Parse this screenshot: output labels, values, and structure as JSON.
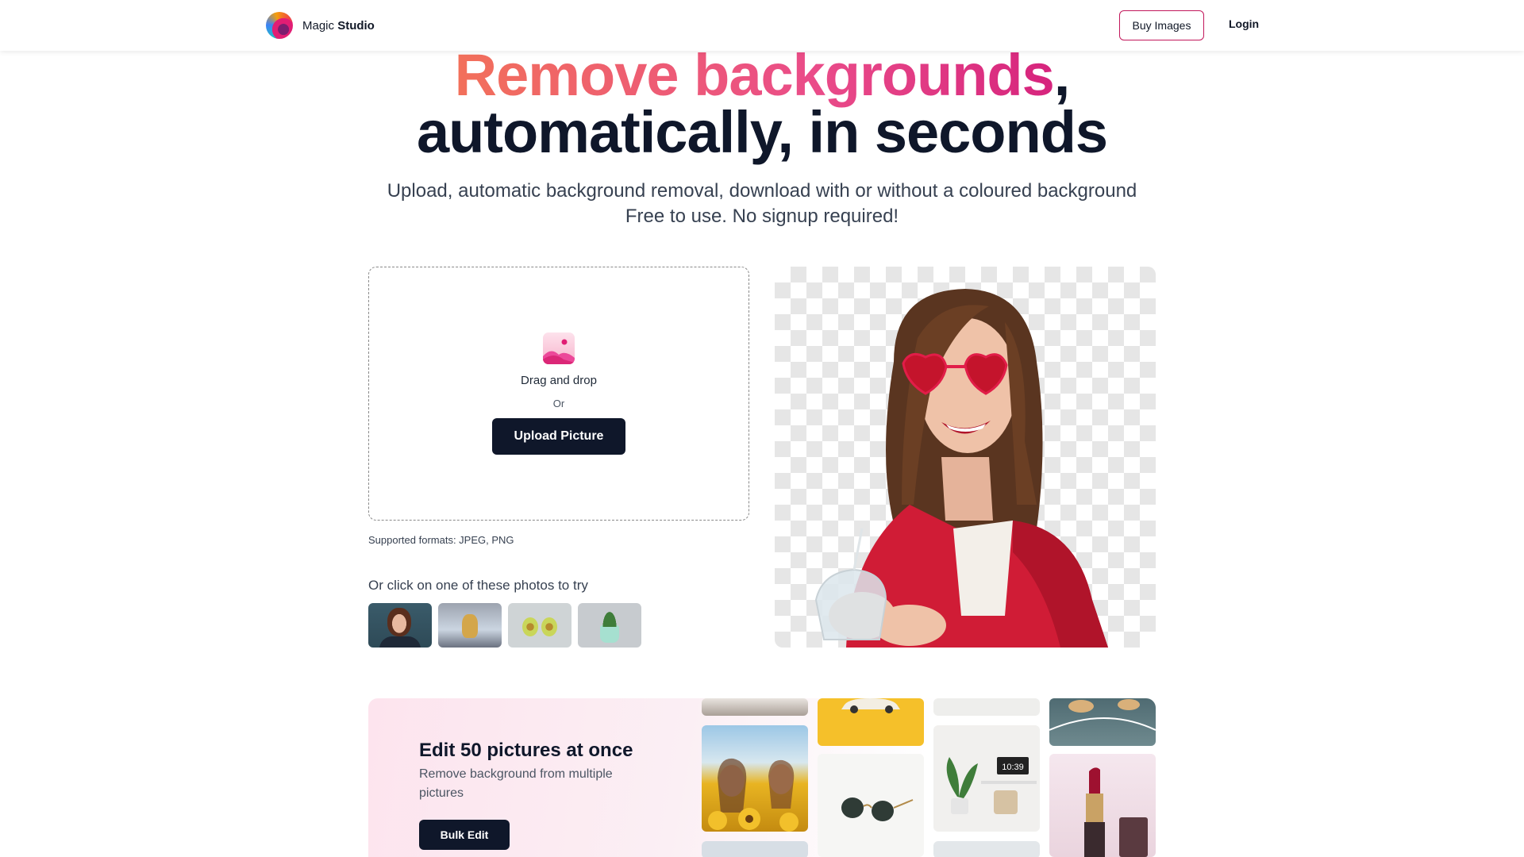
{
  "nav": {
    "brand_light": "Magic",
    "brand_bold": "Studio",
    "buy_label": "Buy Images",
    "login_label": "Login"
  },
  "hero": {
    "title_highlight": "Remove backgrounds",
    "title_comma": ",",
    "title_line2": "automatically, in seconds",
    "subtitle_line1": "Upload, automatic background removal, download with or without a coloured background",
    "subtitle_line2": "Free to use. No signup required!"
  },
  "upload": {
    "drag_text": "Drag and drop",
    "or_text": "Or",
    "button_label": "Upload Picture",
    "formats_text": "Supported formats: JPEG, PNG"
  },
  "samples": {
    "prompt": "Or click on one of these photos to try",
    "items": [
      "woman-portrait",
      "bird-figurine",
      "avocados",
      "potted-plant"
    ]
  },
  "bulk": {
    "title": "Edit 50 pictures at once",
    "description": "Remove background from multiple pictures",
    "button_label": "Bulk Edit",
    "clock_text": "10:39"
  },
  "colors": {
    "accent_pink": "#ea4c89",
    "accent_coral": "#f2705a",
    "dark": "#0f172a",
    "buy_border": "#c2185b"
  }
}
